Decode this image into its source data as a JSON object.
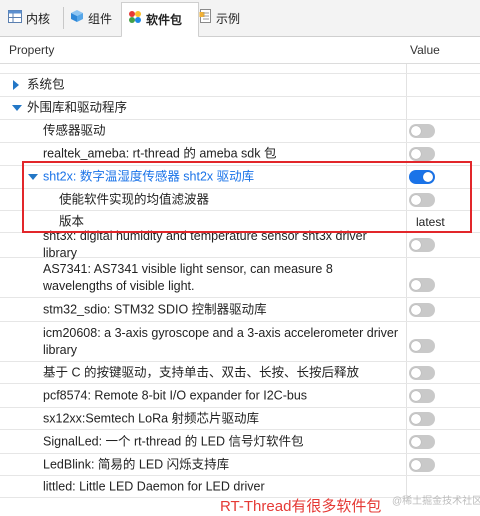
{
  "tabs": [
    {
      "label": "内核",
      "icon": "table-icon"
    },
    {
      "label": "组件",
      "icon": "cube-icon"
    },
    {
      "label": "软件包",
      "icon": "colored-dots-icon"
    },
    {
      "label": "示例",
      "icon": "document-icon"
    }
  ],
  "header": {
    "property": "Property",
    "value": "Value"
  },
  "rows": [
    {
      "label": "",
      "indent": 0
    },
    {
      "label": "系统包",
      "indent": 1,
      "expander": "collapsed"
    },
    {
      "label": "外围库和驱动程序",
      "indent": 1,
      "expander": "expanded"
    },
    {
      "label": "传感器驱动",
      "indent": 2,
      "toggle": false
    },
    {
      "label": "realtek_ameba: rt-thread 的 ameba sdk 包",
      "indent": 2,
      "toggle": false
    },
    {
      "label": "sht2x: 数字温湿度传感器 sht2x 驱动库",
      "indent": 2,
      "expander": "expanded",
      "toggle": true,
      "accent": true
    },
    {
      "label": "使能软件实现的均值滤波器",
      "indent": 3,
      "toggle": false
    },
    {
      "label": "版本",
      "indent": 3,
      "value": "latest"
    },
    {
      "label": "sht3x: digital humidity and temperature sensor sht3x driver library",
      "indent": 2,
      "toggle": false
    },
    {
      "label": "AS7341: AS7341 visible light sensor, can measure 8 wavelengths of visible light.",
      "indent": 2,
      "toggle": false
    },
    {
      "label": "stm32_sdio: STM32 SDIO 控制器驱动库",
      "indent": 2,
      "toggle": false
    },
    {
      "label": "icm20608: a 3-axis gyroscope and a 3-axis accelerometer driver library",
      "indent": 2,
      "toggle": false
    },
    {
      "label": "基于 C 的按键驱动，支持单击、双击、长按、长按后释放",
      "indent": 2,
      "toggle": false
    },
    {
      "label": "pcf8574: Remote 8-bit I/O expander for I2C-bus",
      "indent": 2,
      "toggle": false
    },
    {
      "label": "sx12xx:Semtech LoRa 射频芯片驱动库",
      "indent": 2,
      "toggle": false
    },
    {
      "label": "SignalLed: 一个 rt-thread 的 LED 信号灯软件包",
      "indent": 2,
      "toggle": false
    },
    {
      "label": "LedBlink: 简易的 LED 闪烁支持库",
      "indent": 2,
      "toggle": false
    },
    {
      "label": "littled: Little LED Daemon for LED driver",
      "indent": 2,
      "toggle": false
    }
  ],
  "caption": "RT-Thread有很多软件包",
  "watermark": "@稀土掘金技术社区",
  "colors": {
    "accent": "#1a73e8",
    "highlight": "#e2262a",
    "toggle_off": "#c9c9c9"
  }
}
